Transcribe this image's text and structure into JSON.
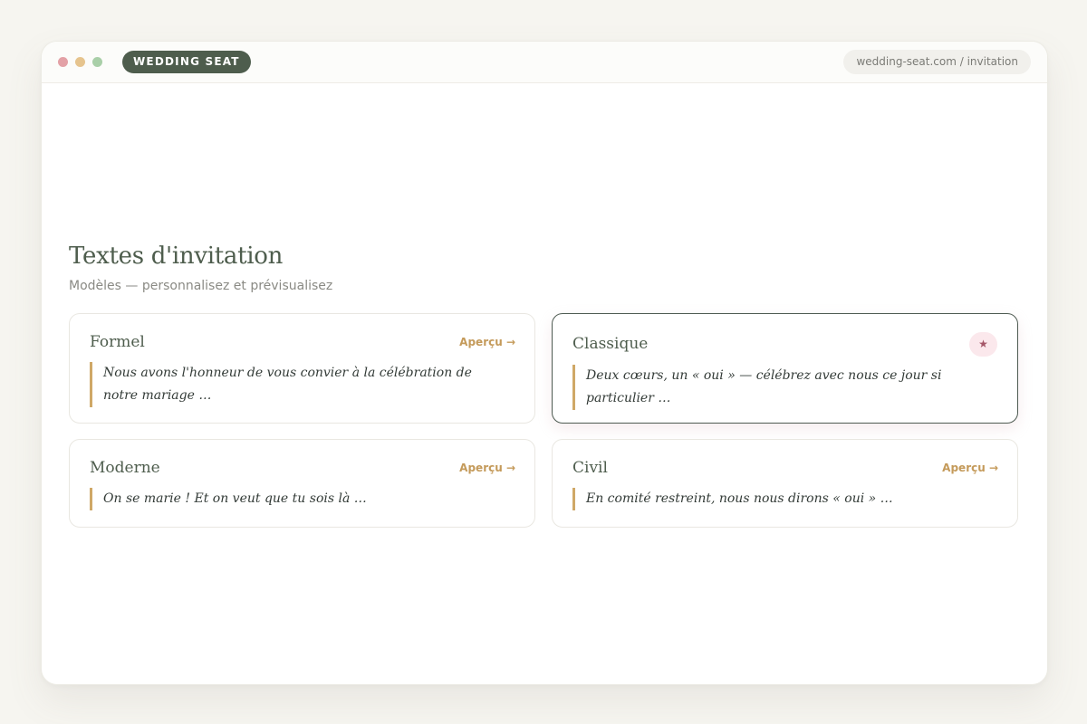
{
  "window": {
    "brand": "WEDDING SEAT",
    "url": "wedding-seat.com / invitation"
  },
  "page": {
    "title": "Textes d'invitation",
    "subtitle": "Modèles — personnalisez et prévisualisez"
  },
  "cards": [
    {
      "title": "Formel",
      "action": "Aperçu →",
      "excerpt": "Nous avons l'honneur de vous convier à la célébration de notre mariage …"
    },
    {
      "title": "Classique",
      "badge": "★",
      "excerpt": "Deux cœurs, un « oui » — célébrez avec nous ce jour si particulier …"
    },
    {
      "title": "Moderne",
      "action": "Aperçu →",
      "excerpt": "On se marie ! Et on veut que tu sois là …"
    },
    {
      "title": "Civil",
      "action": "Aperçu →",
      "excerpt": "En comité restreint, nous nous dirons « oui » …"
    }
  ],
  "colors": {
    "brand": "#4e5d4d",
    "accent": "#c49a5a",
    "favorite": "#a55668"
  }
}
